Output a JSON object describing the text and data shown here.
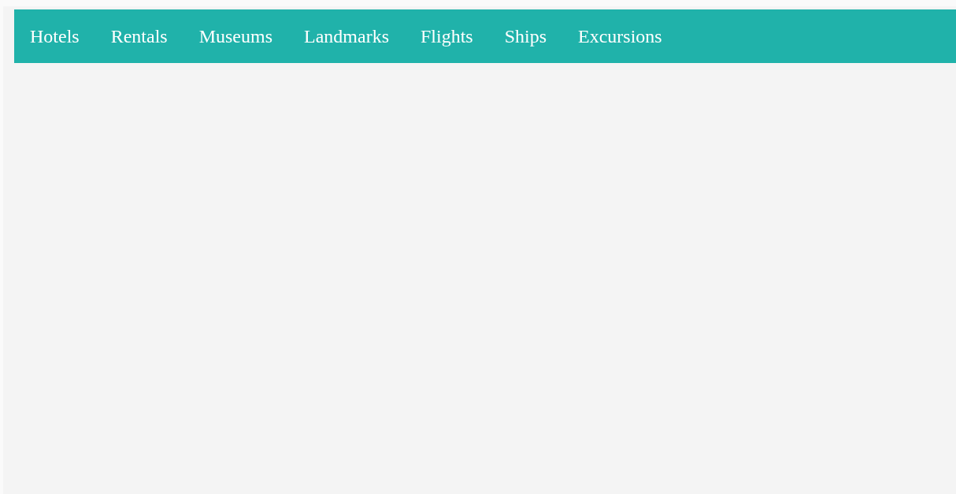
{
  "nav": {
    "items": [
      "Hotels",
      "Rentals",
      "Museums",
      "Landmarks",
      "Flights",
      "Ships",
      "Excursions"
    ]
  }
}
